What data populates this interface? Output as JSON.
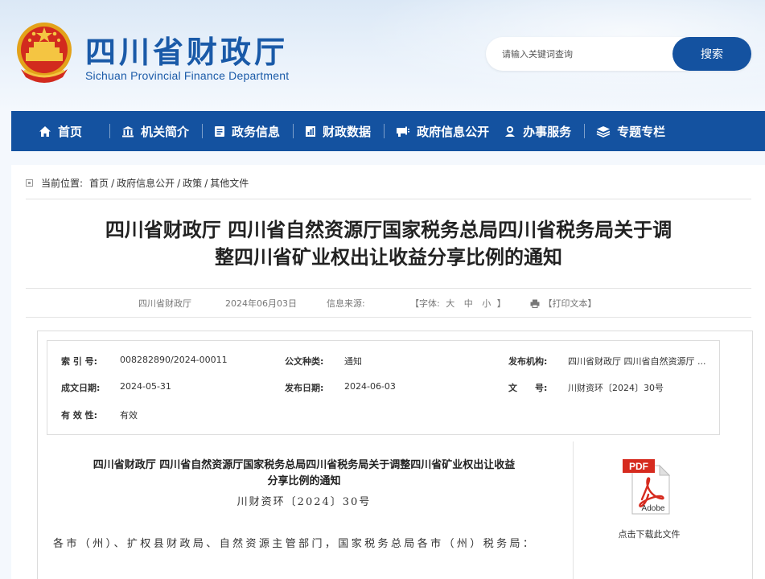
{
  "header": {
    "site_title": "四川省财政厅",
    "site_subtitle": "Sichuan Provincial Finance Department",
    "search": {
      "placeholder": "请输入关键词查询",
      "button_label": "搜索"
    }
  },
  "nav": {
    "items": [
      {
        "label": "首页",
        "icon": "home-icon"
      },
      {
        "label": "机关简介",
        "icon": "building-icon"
      },
      {
        "label": "政务信息",
        "icon": "document-icon"
      },
      {
        "label": "财政数据",
        "icon": "chart-icon"
      },
      {
        "label": "政府信息公开",
        "icon": "megaphone-icon"
      },
      {
        "label": "办事服务",
        "icon": "user-service-icon"
      },
      {
        "label": "专题专栏",
        "icon": "layers-icon"
      }
    ]
  },
  "breadcrumb": {
    "prefix": "当前位置:",
    "items": [
      "首页",
      "政府信息公开",
      "政策",
      "其他文件"
    ],
    "separator": "/"
  },
  "doc": {
    "title_line1": "四川省财政厅 四川省自然资源厅国家税务总局四川省税务局关于调",
    "title_line2": "整四川省矿业权出让收益分享比例的通知",
    "meta": {
      "publisher": "四川省财政厅",
      "date": "2024年06月03日",
      "source_label": "信息来源:",
      "font_label": "【字体:",
      "font_large": "大",
      "font_medium": "中",
      "font_small": "小",
      "font_close": "】",
      "print_label": "【打印文本】"
    },
    "info": {
      "index_label": "索 引 号:",
      "index_value": "008282890/2024-00011",
      "type_label": "公文种类:",
      "type_value": "通知",
      "org_label": "发布机构:",
      "org_value": "四川省财政厅 四川省自然资源厅 ...",
      "created_label": "成文日期:",
      "created_value": "2024-05-31",
      "published_label": "发布日期:",
      "published_value": "2024-06-03",
      "docno_label": "文　　号:",
      "docno_value": "川财资环〔2024〕30号",
      "validity_label": "有 效 性:",
      "validity_value": "有效"
    },
    "body": {
      "title_line1": "四川省财政厅 四川省自然资源厅国家税务总局四川省税务局关于调整四川省矿业权出让收益",
      "title_line2": "分享比例的通知",
      "doc_number": "川财资环〔2024〕30号",
      "paragraph": "各市（州）、扩权县财政局、自然资源主管部门，国家税务总局各市（州）税务局："
    },
    "attachment": {
      "pdf_badge": "PDF",
      "brand": "Adobe",
      "download_label": "点击下载此文件"
    }
  },
  "colors": {
    "primary_blue": "#1452a0",
    "title_blue": "#1a5aa8",
    "pdf_red": "#d62b1f"
  }
}
